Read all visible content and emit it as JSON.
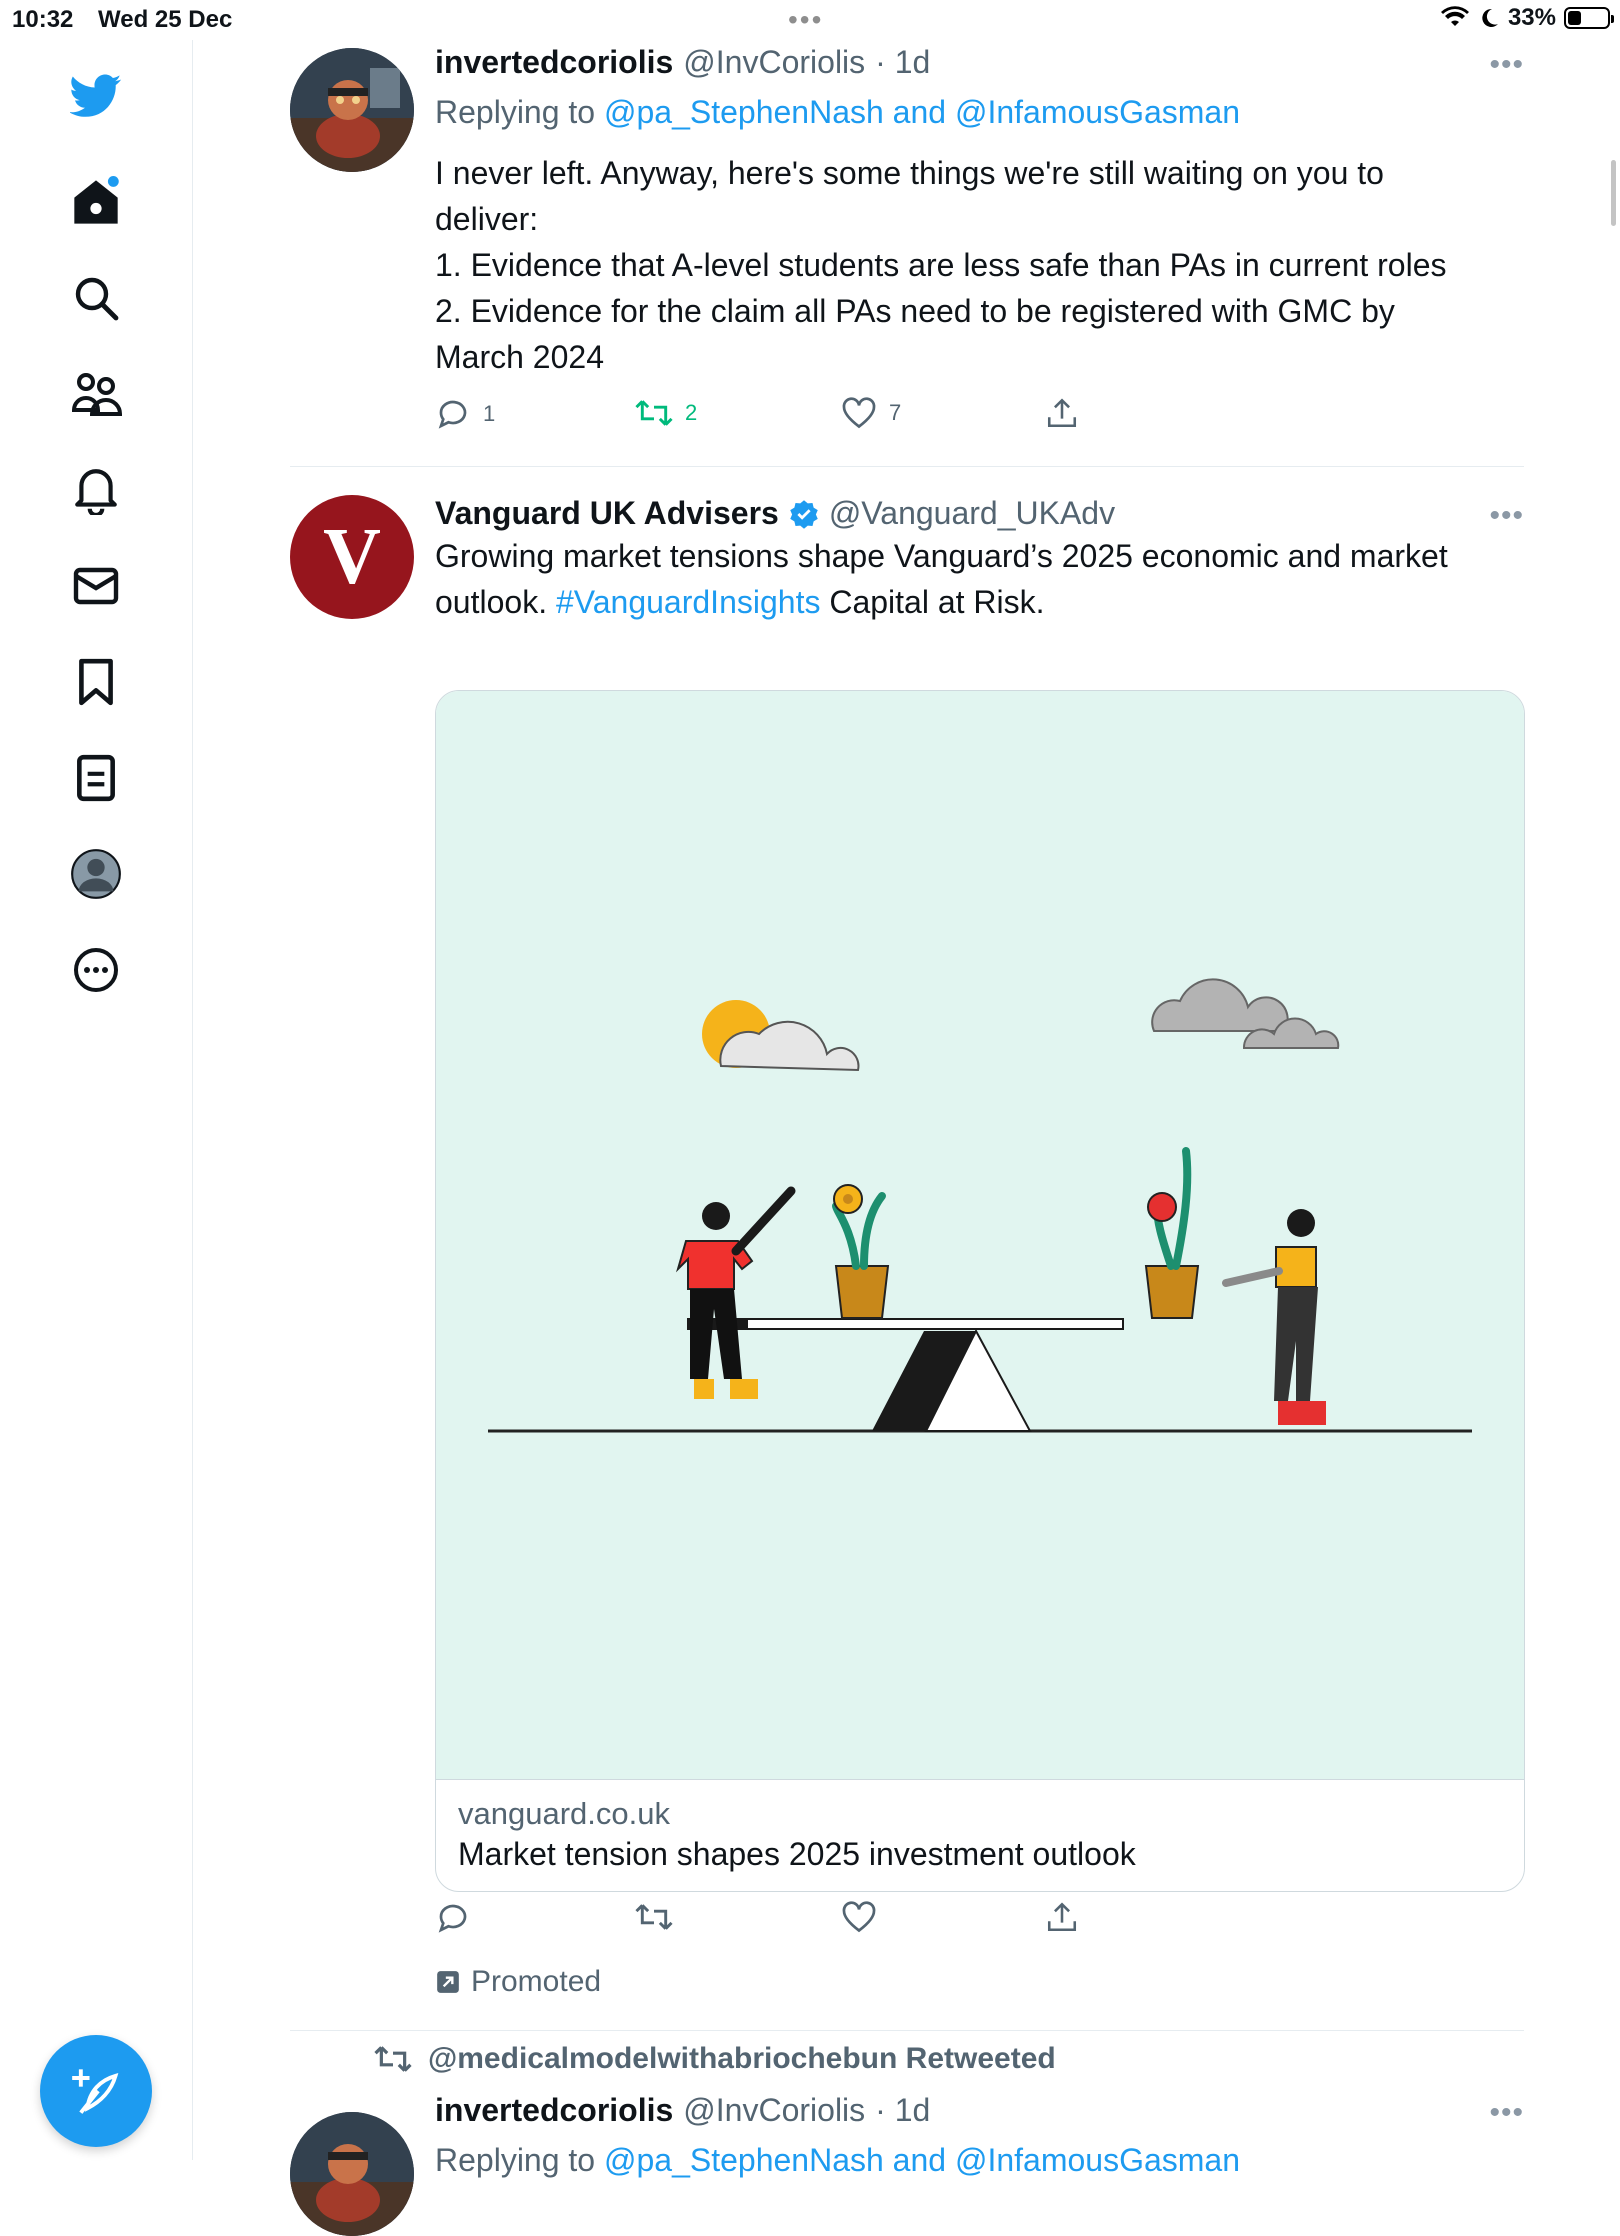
{
  "status_bar": {
    "time": "10:32",
    "date": "Wed 25 Dec",
    "battery": "33%",
    "battery_level": 0.33
  },
  "sidebar": {
    "items": [
      {
        "name": "twitter-logo",
        "icon": "bird-icon"
      },
      {
        "name": "home",
        "icon": "home-icon"
      },
      {
        "name": "explore",
        "icon": "search-icon"
      },
      {
        "name": "communities",
        "icon": "people-icon"
      },
      {
        "name": "notifications",
        "icon": "bell-icon"
      },
      {
        "name": "messages",
        "icon": "mail-icon"
      },
      {
        "name": "bookmarks",
        "icon": "bookmark-icon"
      },
      {
        "name": "lists",
        "icon": "list-icon"
      },
      {
        "name": "profile",
        "icon": "avatar-icon"
      },
      {
        "name": "more",
        "icon": "more-circle-icon"
      }
    ],
    "compose_icon": "feather-plus-icon"
  },
  "tweets": [
    {
      "name": "invertedcoriolis",
      "handle": "@InvCoriolis",
      "time": "· 1d",
      "reply_prefix": "Replying to",
      "reply_users": "@pa_StephenNash and @InfamousGasman",
      "lines": [
        "I never left. Anyway, here's some things we're still waiting on you to",
        "deliver:",
        "1. Evidence that A-level students are less safe than PAs in current roles",
        "2. Evidence for the claim all PAs need to be registered with GMC by",
        "March 2024"
      ],
      "reply_count": "1",
      "retweet_count": "2",
      "like_count": "7"
    },
    {
      "name": "Vanguard UK Advisers",
      "handle": "@Vanguard_UKAdv",
      "text_1": "Growing market tensions shape Vanguard’s 2025 economic and market",
      "text_2a": "outlook. ",
      "hashtag": "#VanguardInsights",
      "text_2b": " Capital at Risk.",
      "card_domain": "vanguard.co.uk",
      "card_title": "Market tension shapes 2025 investment outlook",
      "promoted": "Promoted",
      "avatar_letter": "V"
    },
    {
      "retweeted_by": "@medicalmodelwithabriochebun Retweeted",
      "name": "invertedcoriolis",
      "handle": "@InvCoriolis",
      "time": "· 1d",
      "reply_prefix": "Replying to",
      "reply_users": "@pa_StephenNash and @InfamousGasman"
    }
  ],
  "colors": {
    "accent": "#1d9bf0",
    "retweet_green": "#00ba7c",
    "card_bg": "#e1f5f0",
    "vanguard_red": "#96151d"
  }
}
